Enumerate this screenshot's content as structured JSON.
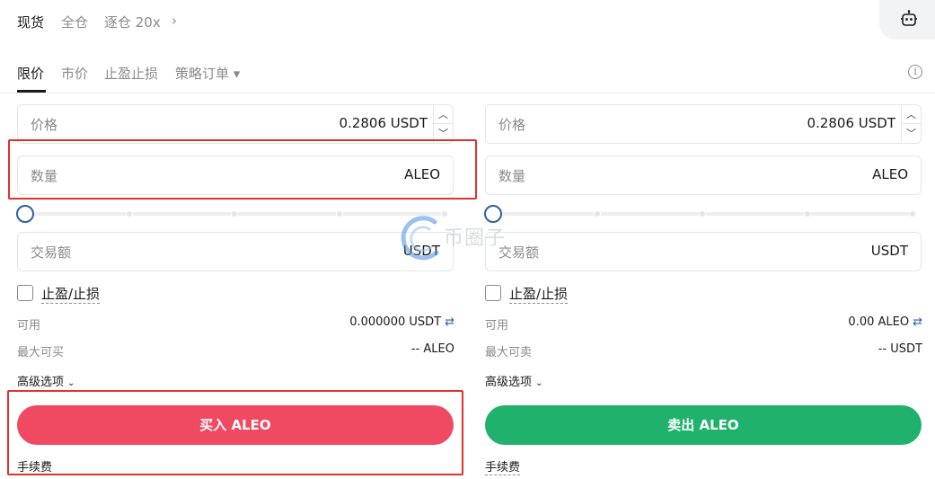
{
  "top_bar": {
    "modes": [
      "现货",
      "全仓",
      "逐仓 20x"
    ],
    "chevron": "›",
    "bot_icon": "robot-icon"
  },
  "order_tabs": {
    "items": [
      "限价",
      "市价",
      "止盈止损",
      "策略订单 ▾"
    ],
    "active": "限价",
    "info_icon": "i"
  },
  "buy": {
    "price_label": "价格",
    "price_value": "0.2806 USDT",
    "qty_label": "数量",
    "qty_unit": "ALEO",
    "amount_label": "交易额",
    "amount_unit": "USDT",
    "tpsl_label": "止盈/止损",
    "available_label": "可用",
    "available_value": "0.000000 USDT",
    "max_label": "最大可买",
    "max_value": "-- ALEO",
    "advanced_label": "高级选项",
    "button_label": "买入 ALEO",
    "fee_label": "手续费",
    "slider_value": 0
  },
  "sell": {
    "price_label": "价格",
    "price_value": "0.2806 USDT",
    "qty_label": "数量",
    "qty_unit": "ALEO",
    "amount_label": "交易额",
    "amount_unit": "USDT",
    "tpsl_label": "止盈/止损",
    "available_label": "可用",
    "available_value": "0.00 ALEO",
    "max_label": "最大可卖",
    "max_value": "-- USDT",
    "advanced_label": "高级选项",
    "button_label": "卖出 ALEO",
    "fee_label": "手续费",
    "slider_value": 0
  },
  "watermark": "币圈子",
  "colors": {
    "buy": "#f04a63",
    "sell": "#20b26c",
    "highlight": "#e0322d",
    "accent": "#2f5ea5"
  }
}
